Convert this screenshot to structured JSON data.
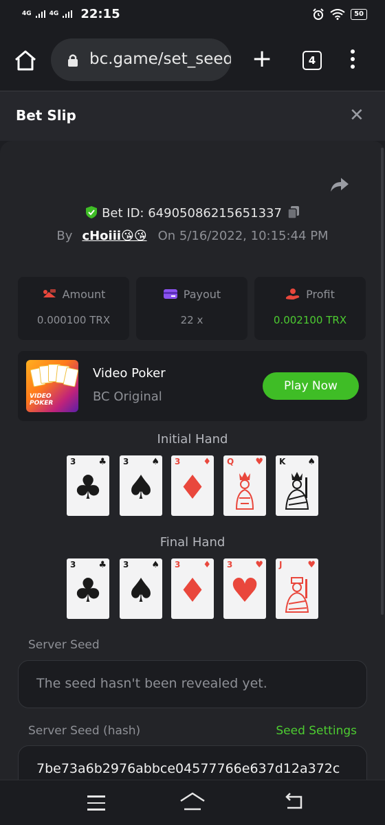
{
  "status": {
    "signal1": "4G",
    "signal2": "4G",
    "time": "22:15",
    "battery": "50"
  },
  "browser": {
    "url": "bc.game/set_seed",
    "tab_count": "4"
  },
  "slip": {
    "title": "Bet Slip",
    "bet_id_label": "Bet ID:",
    "bet_id": "64905086215651337",
    "by_label": "By",
    "username": "cHoiii😘😘",
    "on_label": "On",
    "date": "5/16/2022, 10:15:44 PM"
  },
  "stats": {
    "amount_label": "Amount",
    "amount_value": "0.000100 TRX",
    "payout_label": "Payout",
    "payout_value": "22 x",
    "profit_label": "Profit",
    "profit_value": "0.002100 TRX"
  },
  "game": {
    "name": "Video Poker",
    "provider": "BC Original",
    "thumb_text_1": "VIDEO",
    "thumb_text_2": "POKER",
    "play_label": "Play Now"
  },
  "initial_hand": {
    "title": "Initial Hand",
    "cards": [
      {
        "rank": "3",
        "suit": "♣",
        "color": "blk"
      },
      {
        "rank": "3",
        "suit": "♠",
        "color": "blk"
      },
      {
        "rank": "3",
        "suit": "♦",
        "color": "red"
      },
      {
        "rank": "Q",
        "suit": "♥",
        "color": "red"
      },
      {
        "rank": "K",
        "suit": "♠",
        "color": "blk"
      }
    ]
  },
  "final_hand": {
    "title": "Final Hand",
    "cards": [
      {
        "rank": "3",
        "suit": "♣",
        "color": "blk"
      },
      {
        "rank": "3",
        "suit": "♠",
        "color": "blk"
      },
      {
        "rank": "3",
        "suit": "♦",
        "color": "red"
      },
      {
        "rank": "3",
        "suit": "♥",
        "color": "red"
      },
      {
        "rank": "J",
        "suit": "♥",
        "color": "red"
      }
    ]
  },
  "seeds": {
    "server_seed_label": "Server Seed",
    "server_seed_value": "The seed hasn't been revealed yet.",
    "server_hash_label": "Server Seed (hash)",
    "seed_settings_label": "Seed Settings",
    "server_hash_value": "7be73a6b2976abbce04577766e637d12a372c"
  },
  "colors": {
    "accent_green": "#3fbd26",
    "profit_green": "#4dcc31",
    "card_red": "#e9473c"
  }
}
